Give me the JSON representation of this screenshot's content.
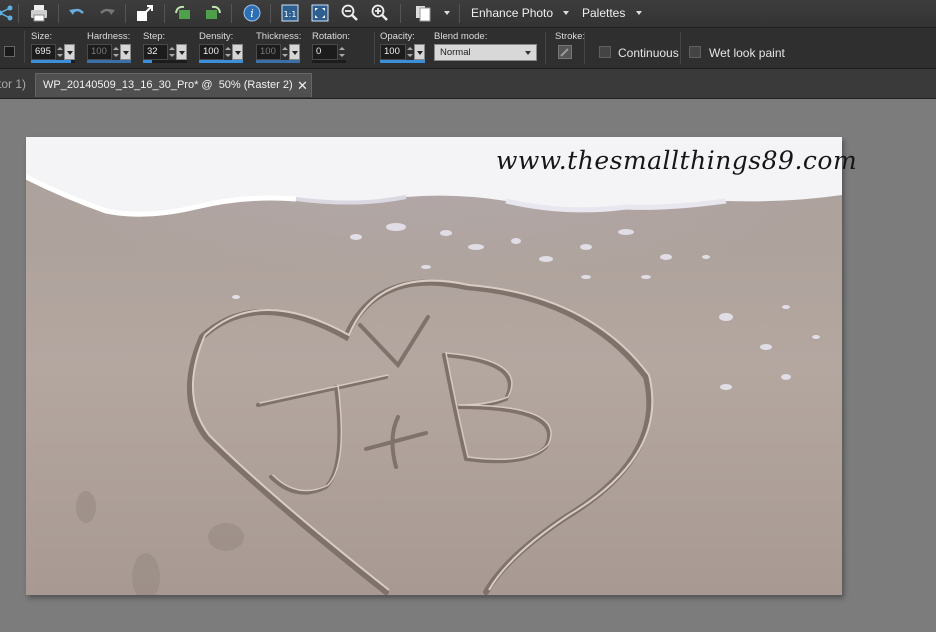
{
  "toolbar": {
    "menus": [
      {
        "label": "Enhance Photo"
      },
      {
        "label": "Palettes"
      }
    ]
  },
  "options": {
    "fields": [
      {
        "label": "Size:",
        "value": "695",
        "enabled": true,
        "fill": 0.9
      },
      {
        "label": "Hardness:",
        "value": "100",
        "enabled": false,
        "fill": 1.0
      },
      {
        "label": "Step:",
        "value": "32",
        "enabled": true,
        "fill": 0.2
      },
      {
        "label": "Density:",
        "value": "100",
        "enabled": true,
        "fill": 1.0
      },
      {
        "label": "Thickness:",
        "value": "100",
        "enabled": false,
        "fill": 1.0
      },
      {
        "label": "Rotation:",
        "value": "0",
        "enabled": true,
        "fill": 0.0
      },
      {
        "label": "Opacity:",
        "value": "100",
        "enabled": true,
        "fill": 1.0
      }
    ],
    "blend_mode": {
      "label": "Blend mode:",
      "value": "Normal"
    },
    "stroke": {
      "label": "Stroke:"
    },
    "continuous": {
      "label": "Continuous",
      "checked": false
    },
    "wet_look": {
      "label": "Wet look paint",
      "checked": false
    }
  },
  "tabs": {
    "previous": "tor 1)",
    "active": "WP_20140509_13_16_30_Pro* @  50% (Raster 2)"
  },
  "photo": {
    "watermark": "www.thesmallthings89.com",
    "sand_text": "J+B"
  }
}
